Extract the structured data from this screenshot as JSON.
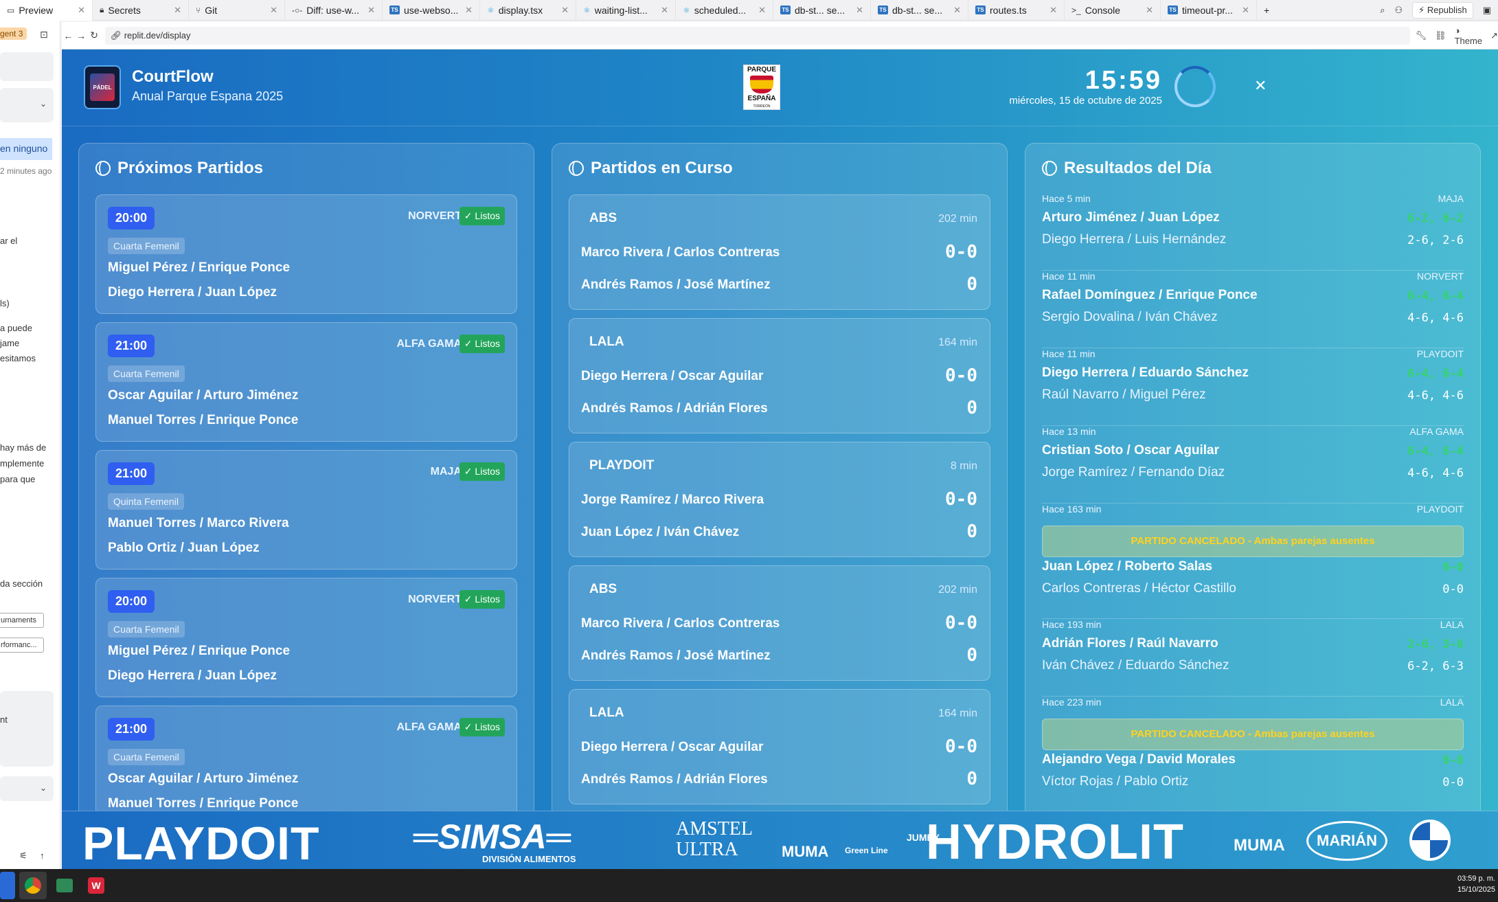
{
  "tabs": [
    {
      "label": "Preview",
      "icon": "monitor-icon"
    },
    {
      "label": "Secrets",
      "icon": "lock-icon"
    },
    {
      "label": "Git",
      "icon": "git-icon"
    },
    {
      "label": "Diff: use-w...",
      "icon": "diff-icon"
    },
    {
      "label": "use-webso...",
      "icon": "ts-file-icon"
    },
    {
      "label": "display.tsx",
      "icon": "react-icon"
    },
    {
      "label": "waiting-list...",
      "icon": "react-icon"
    },
    {
      "label": "scheduled...",
      "icon": "react-icon"
    },
    {
      "label": "db-st... se...",
      "icon": "ts-file-icon"
    },
    {
      "label": "db-st... se...",
      "icon": "ts-file-icon"
    },
    {
      "label": "routes.ts",
      "icon": "ts-file-icon"
    },
    {
      "label": "Console",
      "icon": "terminal-icon"
    },
    {
      "label": "timeout-pr...",
      "icon": "ts-file-icon"
    }
  ],
  "toolbar": {
    "republish_label": "Republish",
    "theme_label": "Theme"
  },
  "address": {
    "url": "replit.dev/display"
  },
  "left_panel": {
    "badge": "gent 3",
    "selected_text": "en ninguno",
    "time_ago": "2 minutes ago",
    "text_a": "ar el",
    "text_b": "ls)",
    "text_c1": "a puede",
    "text_c2": "jame",
    "text_c3": "esitamos",
    "text_d1": "hay más de",
    "text_d2": "mplemente",
    "text_d3": "para que",
    "text_e": "da sección",
    "btn1": "urnaments",
    "btn2": "rformanc...",
    "text_f": "nt"
  },
  "header": {
    "title": "CourtFlow",
    "subtitle": "Anual Parque Espana 2025",
    "logo_text": "PÁDEL",
    "tournament_logo_top": "PARQUE",
    "tournament_logo_bottom": "ESPAÑA",
    "tournament_logo_small": "TORREÓN",
    "clock": "15:59",
    "date": "miércoles, 15 de octubre de 2025"
  },
  "upcoming": {
    "title": "Próximos Partidos",
    "matches": [
      {
        "time": "20:00",
        "court": "NORVERT",
        "status": "✓ Listos",
        "category": "Cuarta Femenil",
        "team1": "Miguel Pérez / Enrique Ponce",
        "team2": "Diego Herrera / Juan López"
      },
      {
        "time": "21:00",
        "court": "ALFA GAMA",
        "status": "✓ Listos",
        "category": "Cuarta Femenil",
        "team1": "Oscar Aguilar / Arturo Jiménez",
        "team2": "Manuel Torres / Enrique Ponce"
      },
      {
        "time": "21:00",
        "court": "MAJA",
        "status": "✓ Listos",
        "category": "Quinta Femenil",
        "team1": "Manuel Torres / Marco Rivera",
        "team2": "Pablo Ortiz / Juan López"
      },
      {
        "time": "20:00",
        "court": "NORVERT",
        "status": "✓ Listos",
        "category": "Cuarta Femenil",
        "team1": "Miguel Pérez / Enrique Ponce",
        "team2": "Diego Herrera / Juan López"
      },
      {
        "time": "21:00",
        "court": "ALFA GAMA",
        "status": "✓ Listos",
        "category": "Cuarta Femenil",
        "team1": "Oscar Aguilar / Arturo Jiménez",
        "team2": "Manuel Torres / Enrique Ponce"
      }
    ]
  },
  "live": {
    "title": "Partidos en Curso",
    "matches": [
      {
        "court": "ABS",
        "duration": "202 min",
        "team1": "Marco Rivera / Carlos Contreras",
        "score1": "0-0",
        "team2": "Andrés Ramos / José Martínez",
        "score2": "0"
      },
      {
        "court": "LALA",
        "duration": "164 min",
        "team1": "Diego Herrera / Oscar Aguilar",
        "score1": "0-0",
        "team2": "Andrés Ramos / Adrián Flores",
        "score2": "0"
      },
      {
        "court": "PLAYDOIT",
        "duration": "8 min",
        "team1": "Jorge Ramírez / Marco Rivera",
        "score1": "0-0",
        "team2": "Juan López / Iván Chávez",
        "score2": "0"
      },
      {
        "court": "ABS",
        "duration": "202 min",
        "team1": "Marco Rivera / Carlos Contreras",
        "score1": "0-0",
        "team2": "Andrés Ramos / José Martínez",
        "score2": "0"
      },
      {
        "court": "LALA",
        "duration": "164 min",
        "team1": "Diego Herrera / Oscar Aguilar",
        "score1": "0-0",
        "team2": "Andrés Ramos / Adrián Flores",
        "score2": "0"
      }
    ]
  },
  "results": {
    "title": "Resultados del Día",
    "items": [
      {
        "ago": "Hace 5 min",
        "court": "MAJA",
        "winner": "Arturo Jiménez / Juan López",
        "winner_score": "6-2, 6-2",
        "loser": "Diego Herrera / Luis Hernández",
        "loser_score": "2-6, 2-6",
        "cancelled": ""
      },
      {
        "ago": "Hace 11 min",
        "court": "NORVERT",
        "winner": "Rafael Domínguez / Enrique Ponce",
        "winner_score": "6-4, 6-4",
        "loser": "Sergio Dovalina / Iván Chávez",
        "loser_score": "4-6, 4-6",
        "cancelled": ""
      },
      {
        "ago": "Hace 11 min",
        "court": "PLAYDOIT",
        "winner": "Diego Herrera / Eduardo Sánchez",
        "winner_score": "6-4, 6-4",
        "loser": "Raúl Navarro / Miguel Pérez",
        "loser_score": "4-6, 4-6",
        "cancelled": ""
      },
      {
        "ago": "Hace 13 min",
        "court": "ALFA GAMA",
        "winner": "Cristian Soto / Oscar Aguilar",
        "winner_score": "6-4, 6-4",
        "loser": "Jorge Ramírez / Fernando Díaz",
        "loser_score": "4-6, 4-6",
        "cancelled": ""
      },
      {
        "ago": "Hace 163 min",
        "court": "PLAYDOIT",
        "winner": "Juan López / Roberto Salas",
        "winner_score": "0-0",
        "loser": "Carlos Contreras / Héctor Castillo",
        "loser_score": "0-0",
        "cancelled": "PARTIDO CANCELADO - Ambas parejas ausentes"
      },
      {
        "ago": "Hace 193 min",
        "court": "LALA",
        "winner": "Adrián Flores / Raúl Navarro",
        "winner_score": "2-6, 3-6",
        "loser": "Iván Chávez / Eduardo Sánchez",
        "loser_score": "6-2, 6-3",
        "cancelled": ""
      },
      {
        "ago": "Hace 223 min",
        "court": "LALA",
        "winner": "Alejandro Vega / David Morales",
        "winner_score": "0-0",
        "loser": "Víctor Rojas / Pablo Ortiz",
        "loser_score": "0-0",
        "cancelled": "PARTIDO CANCELADO - Ambas parejas ausentes"
      }
    ]
  },
  "sponsors": {
    "playdoit": "PLAYDOIT",
    "simsa": "SIMSA",
    "simsa_sub": "DIVISIÓN ALIMENTOS",
    "amstel1": "AMSTEL",
    "amstel2": "ULTRA",
    "muma1": "MUMA",
    "greenline": "Green Line",
    "jumex": "JUMEX",
    "hydrolit": "HYDROLIT",
    "muma2": "MUMA",
    "marian": "MARIÁN"
  },
  "taskbar": {
    "time": "03:59 p. m.",
    "date": "15/10/2025"
  },
  "colors": {
    "accent": "#2f5ef0",
    "ready": "#22a55a",
    "win_score": "#36d36b",
    "cancel_text": "#ffd21f"
  }
}
